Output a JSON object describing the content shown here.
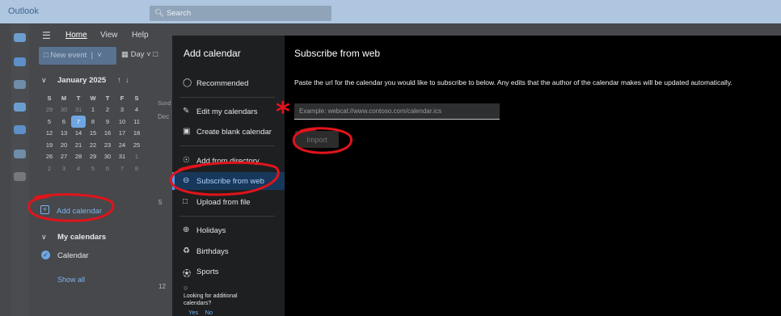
{
  "app": {
    "title": "Outlook",
    "search_placeholder": "Search"
  },
  "ribbon": {
    "tabs": [
      "Home",
      "View",
      "Help"
    ],
    "new_event": "New event",
    "day_view": "Day"
  },
  "mini_calendar": {
    "title": "January 2025",
    "dow": [
      "S",
      "M",
      "T",
      "W",
      "T",
      "F",
      "S"
    ],
    "weeks": [
      [
        "29",
        "30",
        "31",
        "1",
        "2",
        "3",
        "4"
      ],
      [
        "5",
        "6",
        "7",
        "8",
        "9",
        "10",
        "11"
      ],
      [
        "12",
        "13",
        "14",
        "15",
        "16",
        "17",
        "18"
      ],
      [
        "19",
        "20",
        "21",
        "22",
        "23",
        "24",
        "25"
      ],
      [
        "26",
        "27",
        "28",
        "29",
        "30",
        "31",
        "1"
      ],
      [
        "2",
        "3",
        "4",
        "5",
        "6",
        "7",
        "8"
      ]
    ],
    "selected_day": "7"
  },
  "calendar_edge": {
    "day_label": "Sund",
    "month_label": "Dec",
    "date_5": "5",
    "date_12": "12"
  },
  "sidebar": {
    "add_calendar": "Add calendar",
    "my_calendars": "My calendars",
    "calendar_item": "Calendar",
    "show_all": "Show all"
  },
  "dialog": {
    "title": "Add calendar",
    "nav": {
      "recommended": "Recommended",
      "edit_my_calendars": "Edit my calendars",
      "create_blank": "Create blank calendar",
      "add_from_directory": "Add from directory",
      "subscribe_from_web": "Subscribe from web",
      "upload_from_file": "Upload from file",
      "holidays": "Holidays",
      "birthdays": "Birthdays",
      "sports": "Sports"
    },
    "more_prompt_line1": "Looking for additional",
    "more_prompt_line2": "calendars?",
    "yes": "Yes",
    "no": "No"
  },
  "subscribe_panel": {
    "title": "Subscribe from web",
    "description": "Paste the url for the calendar you would like to subscribe to below. Any edits that the author of the calendar makes will be updated automatically.",
    "url_value": "",
    "url_placeholder": "Example: webcal://www.contoso.com/calendar.ics",
    "import_label": "Import"
  },
  "annotation": {
    "color": "#e0141b",
    "asterisk": "*"
  }
}
